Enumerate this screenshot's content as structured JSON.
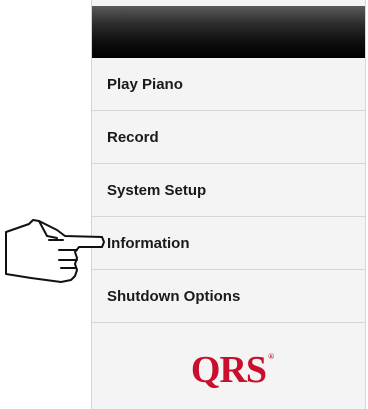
{
  "menu": {
    "items": [
      {
        "label": "Play Piano"
      },
      {
        "label": "Record"
      },
      {
        "label": "System Setup"
      },
      {
        "label": "Information"
      },
      {
        "label": "Shutdown Options"
      }
    ]
  },
  "logo": {
    "text": "QRS",
    "mark": "®"
  },
  "colors": {
    "brand": "#c8102e",
    "header": "#000000",
    "menu_bg": "#f4f4f4"
  },
  "pointer": {
    "icon": "pointing-hand-icon",
    "target": "Information"
  }
}
